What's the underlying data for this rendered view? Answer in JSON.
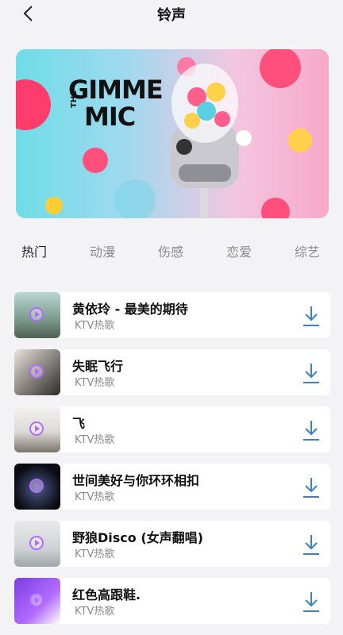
{
  "header": {
    "title": "铃声",
    "back_icon": "chevron-left-icon"
  },
  "banner": {
    "line1": "GIMME",
    "the": "THE",
    "line2": "MIC"
  },
  "tabs": [
    {
      "label": "热门",
      "active": true
    },
    {
      "label": "动漫",
      "active": false
    },
    {
      "label": "伤感",
      "active": false
    },
    {
      "label": "恋爱",
      "active": false
    },
    {
      "label": "综艺",
      "active": false
    }
  ],
  "songs": [
    {
      "title": "黄依玲 - 最美的期待",
      "subtitle": "KTV热歌"
    },
    {
      "title": "失眠飞行",
      "subtitle": "KTV热歌"
    },
    {
      "title": "飞",
      "subtitle": "KTV热歌"
    },
    {
      "title": "世间美好与你环环相扣",
      "subtitle": "KTV热歌"
    },
    {
      "title": "野狼Disco (女声翻唱)",
      "subtitle": "KTV热歌"
    },
    {
      "title": "红色高跟鞋.",
      "subtitle": "KTV热歌"
    }
  ],
  "colors": {
    "accent": "#3b82c4",
    "play": "#b06bff"
  }
}
